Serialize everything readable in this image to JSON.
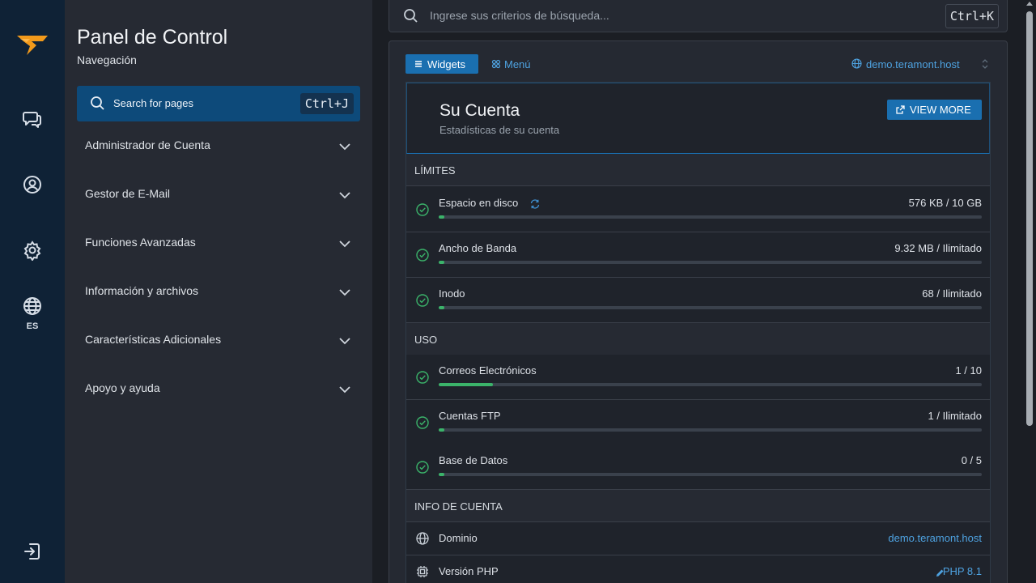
{
  "rail": {
    "items": [
      {
        "icon": "chat-icon"
      },
      {
        "icon": "user-circle-icon"
      },
      {
        "icon": "gear-icon"
      },
      {
        "icon": "globe-icon"
      }
    ],
    "language": "ES",
    "logout_icon": "logout-icon"
  },
  "nav": {
    "title": "Panel de Control",
    "subtitle": "Navegación",
    "search_label": "Search for pages",
    "search_shortcut": "Ctrl+J",
    "items": [
      {
        "label": "Administrador de Cuenta"
      },
      {
        "label": "Gestor de E-Mail"
      },
      {
        "label": "Funciones Avanzadas"
      },
      {
        "label": "Información y archivos"
      },
      {
        "label": "Características Adicionales"
      },
      {
        "label": "Apoyo y ayuda"
      }
    ]
  },
  "topbar": {
    "search_placeholder": "Ingrese sus criterios de búsqueda...",
    "search_shortcut": "Ctrl+K"
  },
  "tabs": {
    "widgets": "Widgets",
    "menu": "Menú",
    "active": "widgets"
  },
  "domain_selector": "demo.teramont.host",
  "account": {
    "title": "Su Cuenta",
    "subtitle": "Estadísticas de su cuenta",
    "view_more": "VIEW MORE"
  },
  "limits": {
    "heading": "LÍMITES",
    "rows": [
      {
        "label": "Espacio en disco",
        "value": "576 KB / 10 GB",
        "fill": 0.01
      },
      {
        "label": "Ancho de Banda",
        "value": "9.32 MB / Ilimitado",
        "fill": 0.01
      },
      {
        "label": "Inodo",
        "value": "68 / Ilimitado",
        "fill": 0.01
      }
    ]
  },
  "usage": {
    "heading": "USO",
    "rows": [
      {
        "label": "Correos Electrónicos",
        "value": "1 / 10",
        "fill": 0.1
      },
      {
        "label": "Cuentas FTP",
        "value": "1 / Ilimitado",
        "fill": 0.01
      },
      {
        "label": "Base de Datos",
        "value": "0 / 5",
        "fill": 0.01
      }
    ]
  },
  "account_info": {
    "heading": "INFO DE CUENTA",
    "domain_label": "Dominio",
    "domain_value": "demo.teramont.host",
    "php_label": "Versión PHP",
    "php_value": "PHP 8.1"
  },
  "colors": {
    "accent": "#1a6fb0",
    "link": "#4ea2e0",
    "success": "#3bb36a",
    "rail_bg": "#0f2236",
    "sidebar_bg": "#262a33"
  }
}
